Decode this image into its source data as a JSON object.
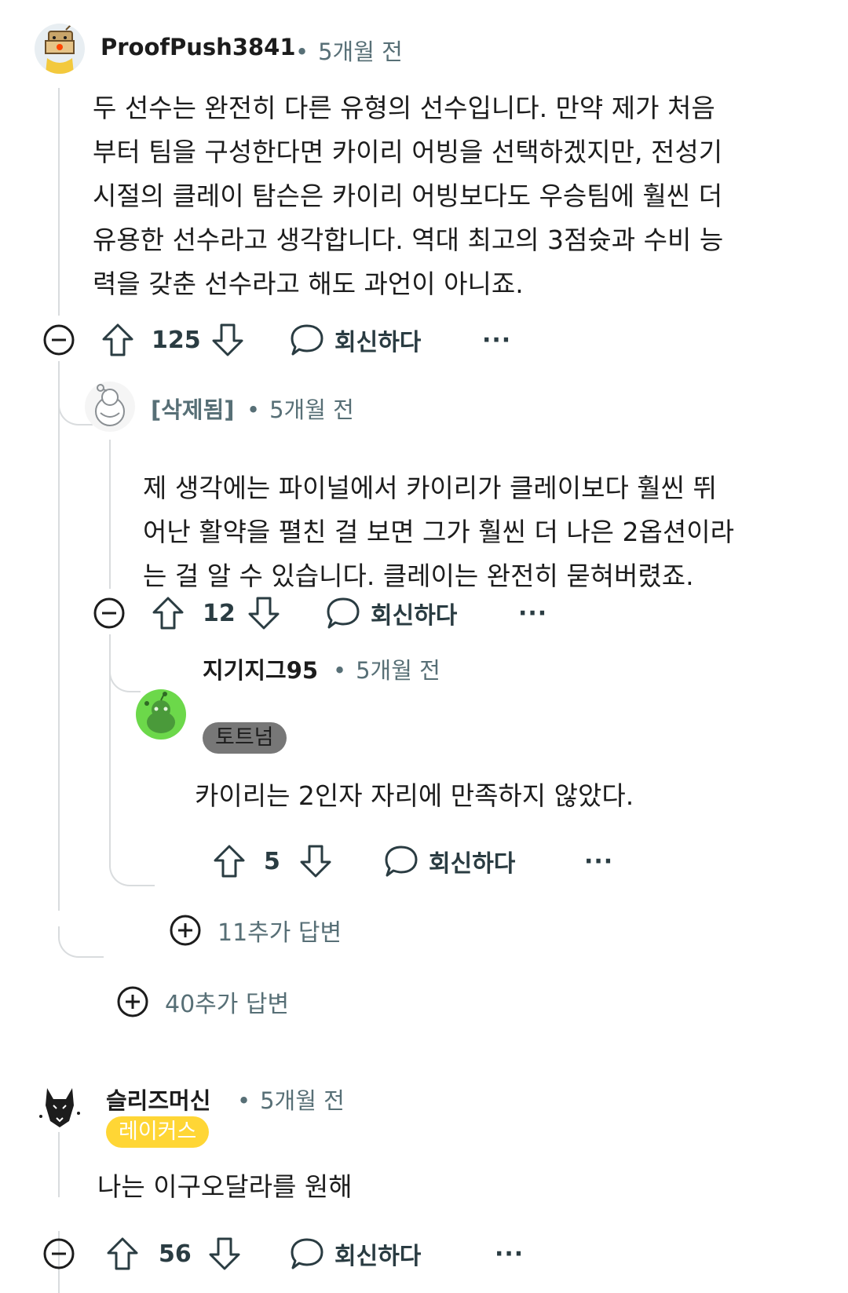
{
  "comments": [
    {
      "username": "ProofPush3841",
      "time": "5개월 전",
      "avatar_icon": "robot-box-avatar-icon",
      "body": [
        "두 선수는 완전히 다른 유형의 선수입니다. 만약 제가 처음",
        "부터 팀을 구성한다면 카이리 어빙을 선택하겠지만, 전성기",
        "시절의 클레이 탐슨은 카이리 어빙보다도 우승팀에 훨씬 더",
        "유용한 선수라고 생각합니다. 역대 최고의 3점슛과 수비 능",
        "력을 갖춘 선수라고 해도 과언이 아니죠."
      ],
      "votes": "125",
      "reply_label": "회신하다",
      "more_label": "···"
    },
    {
      "username": "[삭제됨]",
      "time": "5개월 전",
      "avatar_icon": "deleted-user-avatar-icon",
      "body": [
        "제 생각에는 파이널에서 카이리가 클레이보다 훨씬 뛰",
        "어난 활약을 펼친 걸 보면 그가 훨씬 더 나은 2옵션이라",
        "는 걸 알 수 있습니다. 클레이는 완전히 묻혀버렸죠."
      ],
      "votes": "12",
      "reply_label": "회신하다",
      "more_label": "···"
    },
    {
      "username": "지기지그95",
      "time": "5개월 전",
      "flair": "토트넘",
      "avatar_icon": "green-snoo-avatar-icon",
      "body": [
        "카이리는 2인자 자리에 만족하지 않았다."
      ],
      "votes": "5",
      "reply_label": "회신하다",
      "more_label": "···"
    },
    {
      "username": "슬리즈머신",
      "time": "5개월 전",
      "flair": "레이커스",
      "avatar_icon": "wolf-avatar-icon",
      "body": [
        "나는 이구오달라를 원해"
      ],
      "votes": "56",
      "reply_label": "회신하다",
      "more_label": "···"
    }
  ],
  "more_replies": [
    {
      "label": "11추가 답변"
    },
    {
      "label": "40추가 답변"
    }
  ],
  "colors": {
    "text": "#1c1c1c",
    "meta": "#576f76",
    "thread_line": "#d9dcde",
    "flair_gray": "#6b6b6b",
    "flair_gold": "#ffd635"
  }
}
